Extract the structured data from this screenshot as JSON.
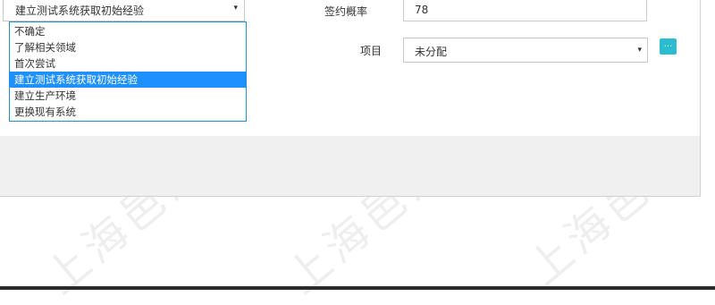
{
  "select": {
    "value": "建立测试系统获取初始经验",
    "arrow": "▾"
  },
  "dropdown": {
    "options": [
      "不确定",
      "了解相关领域",
      "首次尝试",
      "建立测试系统获取初始经验",
      "建立生产环境",
      "更换现有系统"
    ],
    "selected_index": 3
  },
  "fields": {
    "probability_label": "签约概率",
    "probability_value": "78",
    "project_label": "项目",
    "project_value": "未分配",
    "project_arrow": "▾",
    "more_label": "..."
  },
  "watermark": "上海邑泊",
  "colors": {
    "selection": "#1e90ff",
    "button": "#2bbcd0"
  }
}
